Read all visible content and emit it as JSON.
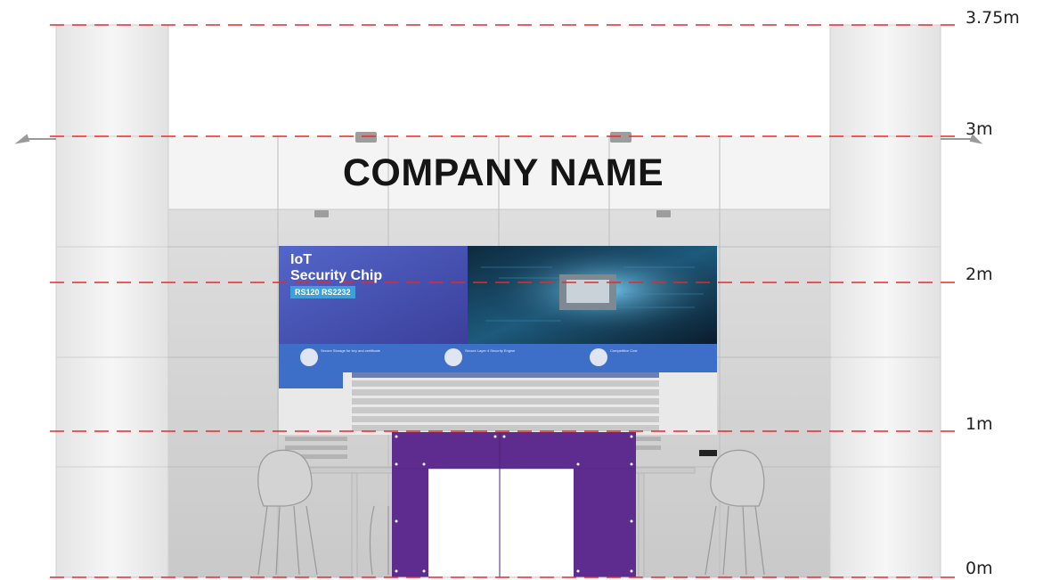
{
  "booth": {
    "company_name": "COMPANY NAME"
  },
  "poster": {
    "title_line1": "IoT",
    "title_line2": "Security Chip",
    "model_badge": "RS120  RS2232",
    "features": [
      "Secure Storage for key and certificate",
      "Secure Layer 4 Security Engine",
      "Competitive Cost"
    ]
  },
  "height_scale": {
    "labels": [
      "3.75m",
      "3m",
      "2m",
      "1m",
      "0m"
    ]
  },
  "colors": {
    "guide_line": "#e32b2b",
    "door_panel": "#5e2c8f",
    "poster_blue": "#4b5bbf",
    "panel_white": "#f1f1f1",
    "wall_gray": "#d6d6d6"
  }
}
